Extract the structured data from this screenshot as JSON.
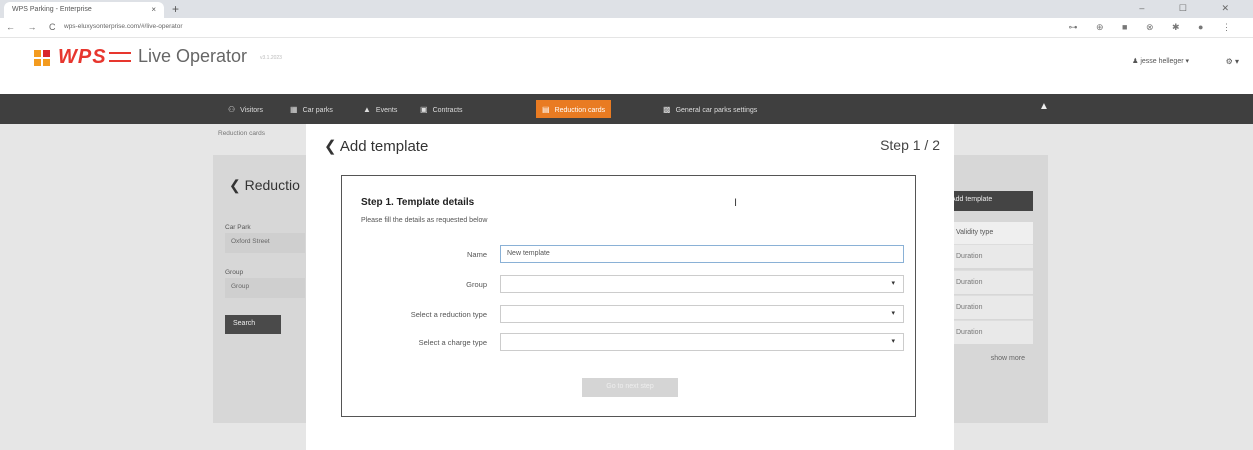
{
  "browser": {
    "tab_title": "WPS Parking - Enterprise",
    "tab_close": "×",
    "new_tab": "+",
    "window_controls": "– ☐ ✕",
    "nav_buttons": "← → C",
    "url": "wps-eluxysonterprise.com/#/live-operator",
    "extension_icons": "⊶ ⊕ ■ ⊗ ✱ ●  ⋮"
  },
  "app": {
    "brand": "WPS",
    "title": "Live Operator",
    "title_sub": "v3.1.2023",
    "user": "♟ jesse helleger ▾",
    "settings": "⚙ ▾"
  },
  "nav": {
    "items": [
      {
        "icon": "visitors-icon",
        "glyph": "⚇",
        "label": "Visitors"
      },
      {
        "icon": "car-park-icon",
        "glyph": "▦",
        "label": "Car parks"
      },
      {
        "icon": "events-icon",
        "glyph": "▲",
        "label": "Events"
      },
      {
        "icon": "contracts-icon",
        "glyph": "▣",
        "label": "Contracts"
      },
      {
        "icon": "reduction-cards-icon",
        "glyph": "▤",
        "label": "Reduction cards",
        "active": true
      },
      {
        "icon": "settings-icon",
        "glyph": "▩",
        "label": "General car parks settings"
      }
    ],
    "bell_glyph": "▲"
  },
  "background": {
    "breadcrumb": "Reduction cards",
    "title": "❮  Reductio",
    "car_park_label": "Car Park",
    "car_park_value": "Oxford Street",
    "group_label": "Group",
    "group_value": "Group",
    "search_label": "Search",
    "add_template_label": "Add template",
    "validity_header": "Validity type",
    "validity_cells": [
      "Duration",
      "Duration",
      "Duration",
      "Duration"
    ],
    "show_more": "show more"
  },
  "modal": {
    "back_title": "❮ Add template",
    "step": "Step 1 / 2",
    "form_title": "Step 1. Template details",
    "form_subtitle": "Please fill the details as requested below",
    "fields": [
      {
        "label": "Name",
        "value": "New template",
        "dropdown": false
      },
      {
        "label": "Group",
        "value": "",
        "dropdown": true
      },
      {
        "label": "Select a reduction type",
        "value": "",
        "dropdown": true
      },
      {
        "label": "Select a charge type",
        "value": "",
        "dropdown": true
      }
    ],
    "dropdown_caret": "▾",
    "text_cursor": "I",
    "next_button": "Go to next step"
  }
}
